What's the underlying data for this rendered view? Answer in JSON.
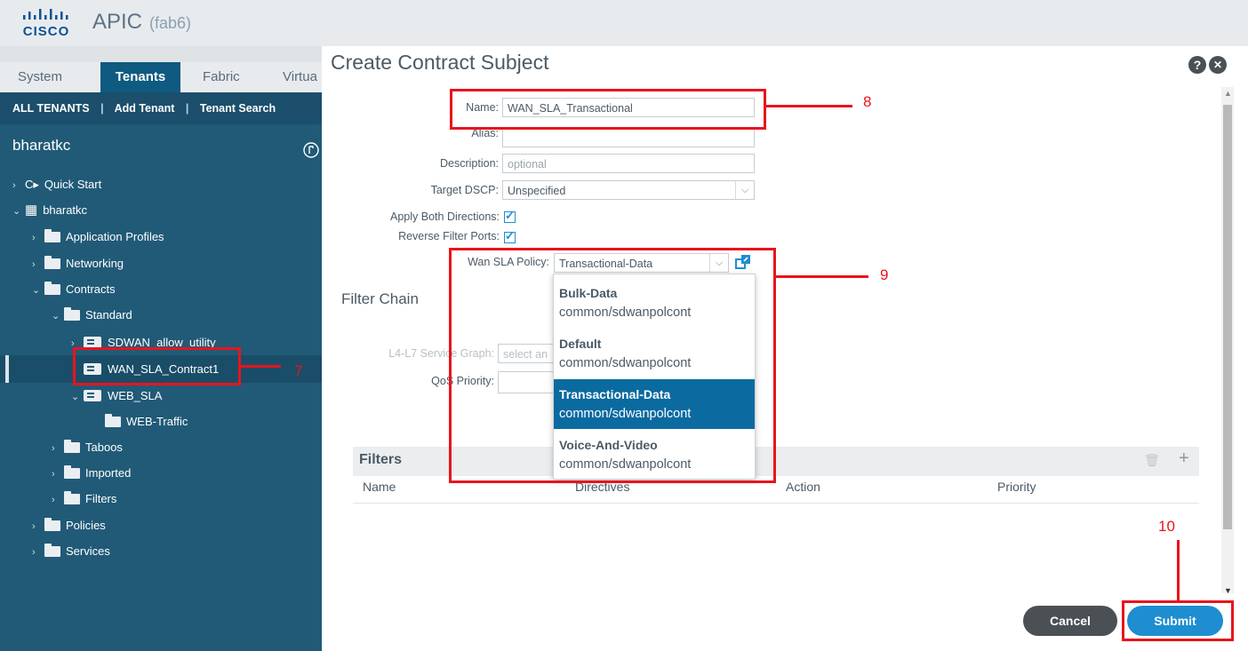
{
  "header": {
    "logo_text": "CISCO",
    "app_name": "APIC",
    "app_sub": "(fab6)"
  },
  "tabs": [
    {
      "label": "System"
    },
    {
      "label": "Tenants"
    },
    {
      "label": "Fabric"
    },
    {
      "label": "Virtua"
    }
  ],
  "sub_nav": {
    "all_tenants": "ALL TENANTS",
    "add_tenant": "Add Tenant",
    "tenant_search": "Tenant Search",
    "separator": "|"
  },
  "sidebar": {
    "tenant": "bharatkc",
    "tree": [
      {
        "label": "Quick Start"
      },
      {
        "label": "bharatkc"
      },
      {
        "label": "Application Profiles"
      },
      {
        "label": "Networking"
      },
      {
        "label": "Contracts"
      },
      {
        "label": "Standard"
      },
      {
        "label": "SDWAN_allow_utility"
      },
      {
        "label": "WAN_SLA_Contract1"
      },
      {
        "label": "WEB_SLA"
      },
      {
        "label": "WEB-Traffic"
      },
      {
        "label": "Taboos"
      },
      {
        "label": "Imported"
      },
      {
        "label": "Filters"
      },
      {
        "label": "Policies"
      },
      {
        "label": "Services"
      }
    ]
  },
  "dialog": {
    "title": "Create Contract Subject",
    "help_glyph": "?",
    "close_glyph": "✕",
    "form": {
      "name_label": "Name:",
      "name_value": "WAN_SLA_Transactional",
      "alias_label": "Alias:",
      "alias_value": "",
      "description_label": "Description:",
      "description_placeholder": "optional",
      "target_dscp_label": "Target DSCP:",
      "target_dscp_value": "Unspecified",
      "apply_both_label": "Apply Both Directions:",
      "apply_both_checked": true,
      "reverse_ports_label": "Reverse Filter Ports:",
      "reverse_ports_checked": true,
      "wan_sla_label": "Wan SLA Policy:",
      "wan_sla_value": "Transactional-Data"
    },
    "filter_chain": {
      "title": "Filter Chain",
      "l4l7_label": "L4-L7 Service Graph:",
      "l4l7_placeholder": "select an",
      "qos_label": "QoS Priority:"
    },
    "wan_sla_options": [
      {
        "name": "Bulk-Data",
        "path": "common/sdwanpolcont",
        "selected": false
      },
      {
        "name": "Default",
        "path": "common/sdwanpolcont",
        "selected": false
      },
      {
        "name": "Transactional-Data",
        "path": "common/sdwanpolcont",
        "selected": true
      },
      {
        "name": "Voice-And-Video",
        "path": "common/sdwanpolcont",
        "selected": false
      }
    ],
    "filters": {
      "title": "Filters",
      "columns": [
        "Name",
        "Directives",
        "Action",
        "Priority"
      ],
      "add_glyph": "+",
      "delete_glyph": "🗑"
    },
    "buttons": {
      "cancel": "Cancel",
      "submit": "Submit"
    }
  },
  "annotations": {
    "n7": "7",
    "n8": "8",
    "n9": "9",
    "n10": "10"
  },
  "colors": {
    "sidebar": "#215a77",
    "accent": "#0b6aa0",
    "annotation": "#e8141c",
    "submit": "#1e8ed0",
    "cancel": "#4b5054"
  }
}
